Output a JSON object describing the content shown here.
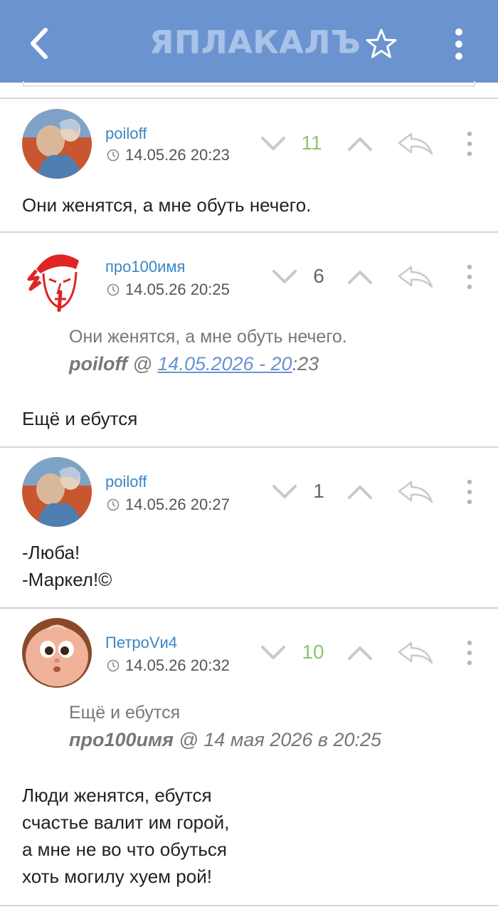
{
  "appbar": {
    "logo_text": "ЯПЛАКАЛЪ",
    "back_icon": "chevron-left-icon",
    "star_icon": "star-outline-icon",
    "more_icon": "more-vert-icon",
    "color": "#6a93cf"
  },
  "posts": [
    {
      "username": "poiloff",
      "timestamp": "14.05.26 20:23",
      "rating": "11",
      "rating_color": "#8cc76a",
      "body": [
        "Они женятся, а мне обуть нечего."
      ]
    },
    {
      "username": "про100имя",
      "timestamp": "14.05.26 20:25",
      "rating": "6",
      "quote": {
        "text": "Они женятся, а мне обуть нечего.",
        "author": "poiloff",
        "at": " @ ",
        "link": "14.05.2026 - 20",
        "tail": ":23"
      },
      "body": [
        "Ещё и ебутся"
      ]
    },
    {
      "username": "poiloff",
      "timestamp": "14.05.26 20:27",
      "rating": "1",
      "body": [
        "-Люба!",
        "-Маркел!©"
      ]
    },
    {
      "username": "ПетроVи4",
      "timestamp": "14.05.26 20:32",
      "rating": "10",
      "rating_color": "#8cc76a",
      "quote": {
        "text": "Ещё и ебутся",
        "author": "про100имя",
        "at": " @ ",
        "date": "14 мая 2026 в 20:25"
      },
      "body": [
        "Люди женятся, ебутся",
        "счастье валит им горой,",
        "а мне не во что обуться",
        "хоть могилу хуем рой!"
      ]
    }
  ]
}
